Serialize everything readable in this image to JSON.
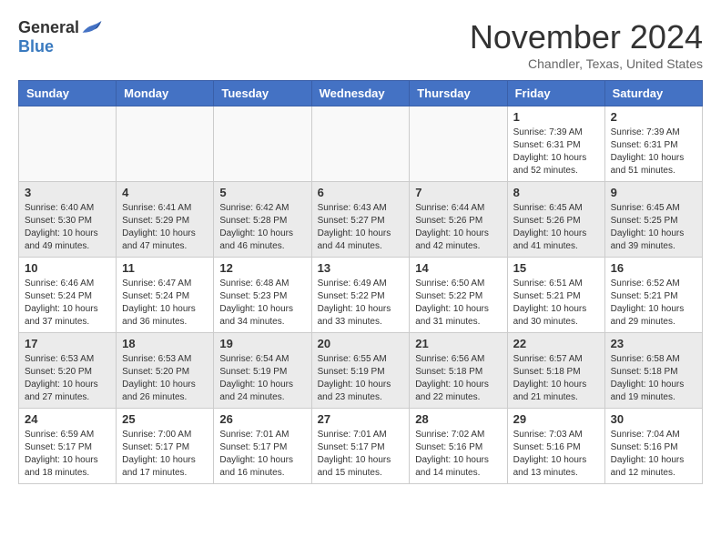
{
  "header": {
    "logo": {
      "general": "General",
      "blue": "Blue"
    },
    "title": "November 2024",
    "location": "Chandler, Texas, United States"
  },
  "days_of_week": [
    "Sunday",
    "Monday",
    "Tuesday",
    "Wednesday",
    "Thursday",
    "Friday",
    "Saturday"
  ],
  "weeks": [
    {
      "days": [
        {
          "num": "",
          "info": ""
        },
        {
          "num": "",
          "info": ""
        },
        {
          "num": "",
          "info": ""
        },
        {
          "num": "",
          "info": ""
        },
        {
          "num": "",
          "info": ""
        },
        {
          "num": "1",
          "info": "Sunrise: 7:39 AM\nSunset: 6:31 PM\nDaylight: 10 hours\nand 52 minutes."
        },
        {
          "num": "2",
          "info": "Sunrise: 7:39 AM\nSunset: 6:31 PM\nDaylight: 10 hours\nand 51 minutes."
        }
      ]
    },
    {
      "days": [
        {
          "num": "3",
          "info": "Sunrise: 6:40 AM\nSunset: 5:30 PM\nDaylight: 10 hours\nand 49 minutes."
        },
        {
          "num": "4",
          "info": "Sunrise: 6:41 AM\nSunset: 5:29 PM\nDaylight: 10 hours\nand 47 minutes."
        },
        {
          "num": "5",
          "info": "Sunrise: 6:42 AM\nSunset: 5:28 PM\nDaylight: 10 hours\nand 46 minutes."
        },
        {
          "num": "6",
          "info": "Sunrise: 6:43 AM\nSunset: 5:27 PM\nDaylight: 10 hours\nand 44 minutes."
        },
        {
          "num": "7",
          "info": "Sunrise: 6:44 AM\nSunset: 5:26 PM\nDaylight: 10 hours\nand 42 minutes."
        },
        {
          "num": "8",
          "info": "Sunrise: 6:45 AM\nSunset: 5:26 PM\nDaylight: 10 hours\nand 41 minutes."
        },
        {
          "num": "9",
          "info": "Sunrise: 6:45 AM\nSunset: 5:25 PM\nDaylight: 10 hours\nand 39 minutes."
        }
      ]
    },
    {
      "days": [
        {
          "num": "10",
          "info": "Sunrise: 6:46 AM\nSunset: 5:24 PM\nDaylight: 10 hours\nand 37 minutes."
        },
        {
          "num": "11",
          "info": "Sunrise: 6:47 AM\nSunset: 5:24 PM\nDaylight: 10 hours\nand 36 minutes."
        },
        {
          "num": "12",
          "info": "Sunrise: 6:48 AM\nSunset: 5:23 PM\nDaylight: 10 hours\nand 34 minutes."
        },
        {
          "num": "13",
          "info": "Sunrise: 6:49 AM\nSunset: 5:22 PM\nDaylight: 10 hours\nand 33 minutes."
        },
        {
          "num": "14",
          "info": "Sunrise: 6:50 AM\nSunset: 5:22 PM\nDaylight: 10 hours\nand 31 minutes."
        },
        {
          "num": "15",
          "info": "Sunrise: 6:51 AM\nSunset: 5:21 PM\nDaylight: 10 hours\nand 30 minutes."
        },
        {
          "num": "16",
          "info": "Sunrise: 6:52 AM\nSunset: 5:21 PM\nDaylight: 10 hours\nand 29 minutes."
        }
      ]
    },
    {
      "days": [
        {
          "num": "17",
          "info": "Sunrise: 6:53 AM\nSunset: 5:20 PM\nDaylight: 10 hours\nand 27 minutes."
        },
        {
          "num": "18",
          "info": "Sunrise: 6:53 AM\nSunset: 5:20 PM\nDaylight: 10 hours\nand 26 minutes."
        },
        {
          "num": "19",
          "info": "Sunrise: 6:54 AM\nSunset: 5:19 PM\nDaylight: 10 hours\nand 24 minutes."
        },
        {
          "num": "20",
          "info": "Sunrise: 6:55 AM\nSunset: 5:19 PM\nDaylight: 10 hours\nand 23 minutes."
        },
        {
          "num": "21",
          "info": "Sunrise: 6:56 AM\nSunset: 5:18 PM\nDaylight: 10 hours\nand 22 minutes."
        },
        {
          "num": "22",
          "info": "Sunrise: 6:57 AM\nSunset: 5:18 PM\nDaylight: 10 hours\nand 21 minutes."
        },
        {
          "num": "23",
          "info": "Sunrise: 6:58 AM\nSunset: 5:18 PM\nDaylight: 10 hours\nand 19 minutes."
        }
      ]
    },
    {
      "days": [
        {
          "num": "24",
          "info": "Sunrise: 6:59 AM\nSunset: 5:17 PM\nDaylight: 10 hours\nand 18 minutes."
        },
        {
          "num": "25",
          "info": "Sunrise: 7:00 AM\nSunset: 5:17 PM\nDaylight: 10 hours\nand 17 minutes."
        },
        {
          "num": "26",
          "info": "Sunrise: 7:01 AM\nSunset: 5:17 PM\nDaylight: 10 hours\nand 16 minutes."
        },
        {
          "num": "27",
          "info": "Sunrise: 7:01 AM\nSunset: 5:17 PM\nDaylight: 10 hours\nand 15 minutes."
        },
        {
          "num": "28",
          "info": "Sunrise: 7:02 AM\nSunset: 5:16 PM\nDaylight: 10 hours\nand 14 minutes."
        },
        {
          "num": "29",
          "info": "Sunrise: 7:03 AM\nSunset: 5:16 PM\nDaylight: 10 hours\nand 13 minutes."
        },
        {
          "num": "30",
          "info": "Sunrise: 7:04 AM\nSunset: 5:16 PM\nDaylight: 10 hours\nand 12 minutes."
        }
      ]
    }
  ]
}
